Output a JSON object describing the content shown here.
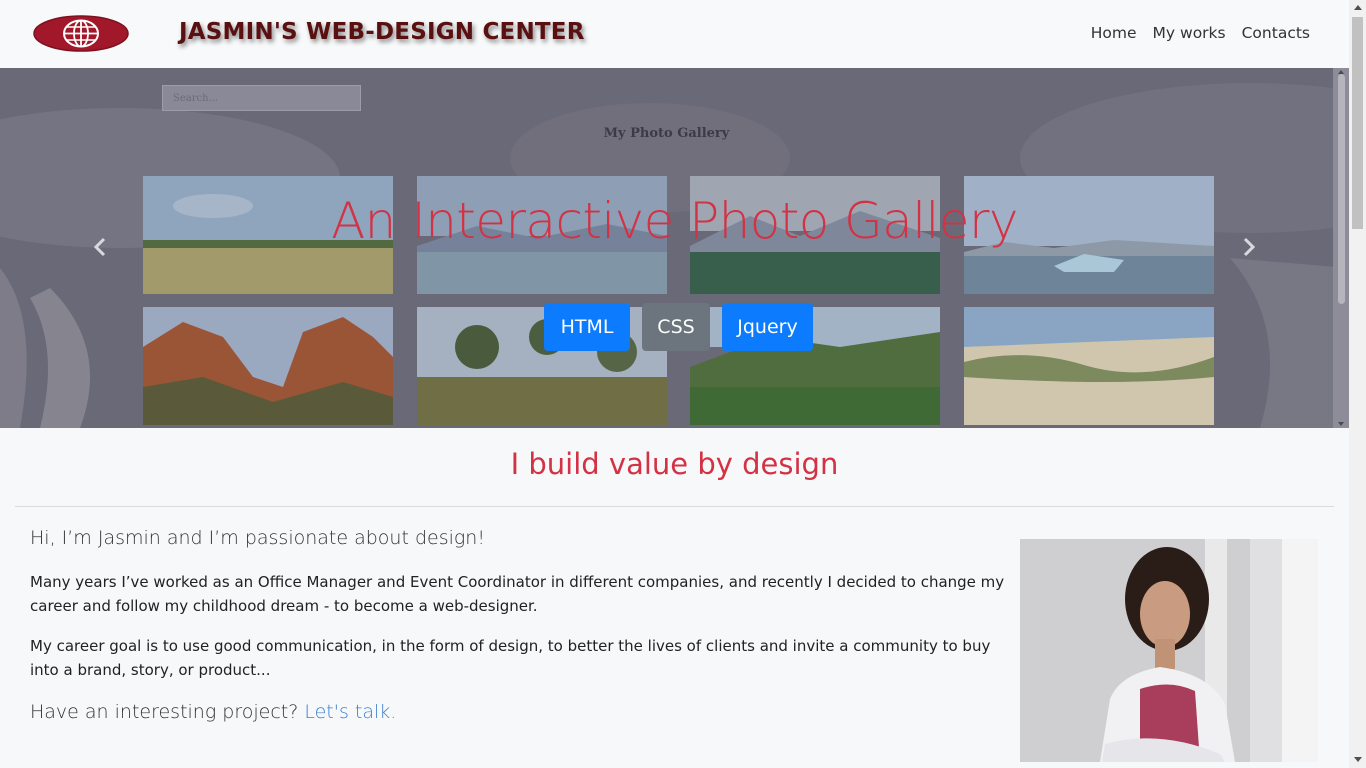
{
  "brand": "JASMIN'S WEB-DESIGN CENTER",
  "nav": {
    "home": "Home",
    "works": "My works",
    "contacts": "Contacts"
  },
  "hero": {
    "search_placeholder": "Search...",
    "gallery_title": "My Photo Gallery",
    "heading": "An Interactive Photo Gallery",
    "buttons": {
      "html": "HTML",
      "css": "CSS",
      "jquery": "Jquery"
    }
  },
  "main": {
    "headline": "I build value by design",
    "intro": "Hi, I’m Jasmin and I’m passionate about design!",
    "paragraph1": "Many years I’ve worked as an Office Manager and Event Coordinator in different companies, and recently I decided to change my career and follow my childhood dream - to become a web-designer.",
    "paragraph2": "My career goal is to use good communication, in the form of design, to better the lives of clients and invite a community to buy into a brand, story, or product...",
    "cta_text": "Have an interesting project?",
    "cta_link": "Let's talk."
  },
  "colors": {
    "accent_red": "#d33244",
    "primary_blue": "#0d7bfd",
    "secondary_gray": "#6c757d",
    "brand_maroon": "#5a1010"
  },
  "icons": [
    "globe-logo-icon",
    "chevron-left-icon",
    "chevron-right-icon"
  ]
}
